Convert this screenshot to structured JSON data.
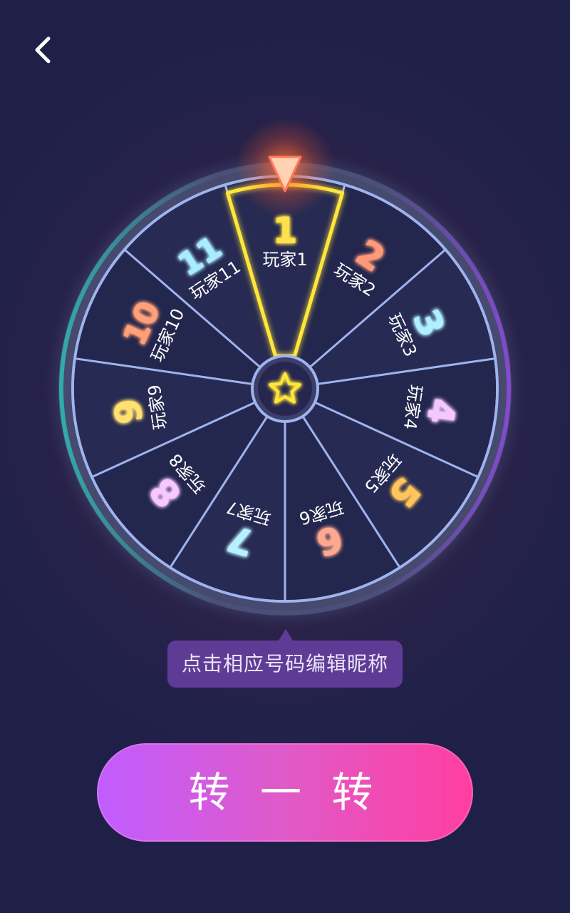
{
  "header": {
    "back_icon": "chevron-left-icon"
  },
  "wheel": {
    "center_icon": "star-icon",
    "pointer_icon": "triangle-pointer-icon",
    "selected_index": 0,
    "highlight_color": "#ffe63a",
    "segments": [
      {
        "number": "1",
        "label": "玩家1",
        "color": "#ffe14a"
      },
      {
        "number": "2",
        "label": "玩家2",
        "color": "#ff9a78"
      },
      {
        "number": "3",
        "label": "玩家3",
        "color": "#aef0ff"
      },
      {
        "number": "4",
        "label": "玩家4",
        "color": "#f4c8ff"
      },
      {
        "number": "5",
        "label": "玩家5",
        "color": "#ffc45a"
      },
      {
        "number": "6",
        "label": "玩家6",
        "color": "#ffa890"
      },
      {
        "number": "7",
        "label": "玩家7",
        "color": "#b8f0ff"
      },
      {
        "number": "8",
        "label": "玩家8",
        "color": "#f6c8ff"
      },
      {
        "number": "9",
        "label": "玩家9",
        "color": "#ffe070"
      },
      {
        "number": "10",
        "label": "玩家10",
        "color": "#ffa078"
      },
      {
        "number": "11",
        "label": "玩家11",
        "color": "#a8ecff"
      }
    ]
  },
  "tooltip": {
    "text": "点击相应号码编辑昵称"
  },
  "spin_button": {
    "label": "转 一 转"
  }
}
